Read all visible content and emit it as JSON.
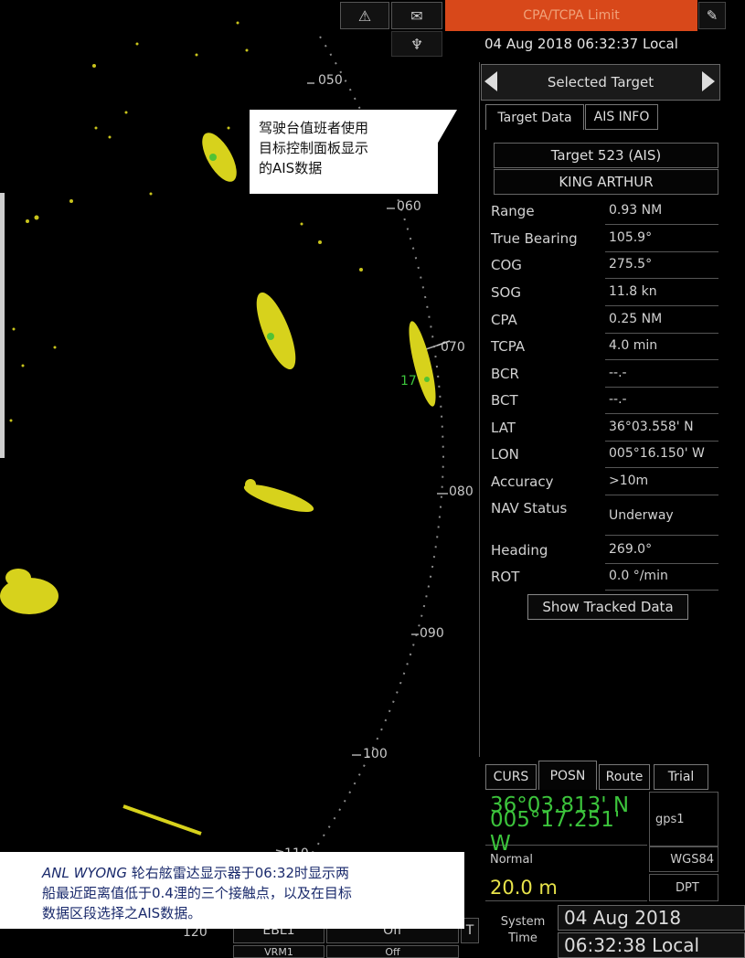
{
  "topbar": {
    "warning_icon": "warning-triangle-icon",
    "message_icon": "envelope-icon",
    "mob_icon": "person-overboard-icon",
    "pen_icon": "pencil-icon",
    "cpa_limit": "CPA/TCPA Limit",
    "datetime": "04 Aug 2018 06:32:37 Local"
  },
  "radar": {
    "bearings": [
      "050",
      "060",
      "070",
      "080",
      "090",
      "100",
      "110",
      "120"
    ],
    "target_label": "17",
    "colors": {
      "echo": "#d7d21c",
      "highlight": "#52c234",
      "label": "#3cc43c"
    }
  },
  "callout": {
    "text_line1": "驾驶台值班者使用",
    "text_line2": "目标控制面板显示",
    "text_line3": "的AIS数据"
  },
  "panel": {
    "header": "Selected Target",
    "tabs": [
      "Target Data",
      "AIS INFO"
    ],
    "target_id": "Target 523 (AIS)",
    "target_name": "KING ARTHUR",
    "rows": [
      {
        "label": "Range",
        "value": "0.93 NM"
      },
      {
        "label": "True Bearing",
        "value": "105.9°"
      },
      {
        "label": "COG",
        "value": "275.5°"
      },
      {
        "label": "SOG",
        "value": "11.8 kn"
      },
      {
        "label": "CPA",
        "value": "0.25 NM"
      },
      {
        "label": "TCPA",
        "value": "4.0 min"
      },
      {
        "label": "BCR",
        "value": "--.-"
      },
      {
        "label": "BCT",
        "value": "--.-"
      },
      {
        "label": "LAT",
        "value": "36°03.558' N"
      },
      {
        "label": "LON",
        "value": "005°16.150' W"
      },
      {
        "label": "Accuracy",
        "value": ">10m"
      },
      {
        "label": "NAV Status",
        "value": "Underway"
      },
      {
        "label": "Heading",
        "value": "269.0°"
      },
      {
        "label": "ROT",
        "value": "0.0 °/min"
      }
    ],
    "show_tracked": "Show Tracked Data"
  },
  "position": {
    "tabs": [
      "CURS",
      "POSN",
      "Route",
      "Trial"
    ],
    "lat": "36°03.813' N",
    "lon": "005°17.251' W",
    "source": "gps1",
    "mode": "Normal",
    "datum": "WGS84",
    "depth": "20.0 m",
    "depth_ref": "DPT",
    "system_time_label_1": "System",
    "system_time_label_2": "Time",
    "system_date": "04 Aug 2018",
    "system_time": "06:32:38 Local"
  },
  "bottom_controls": {
    "ebl1": "EBL1",
    "ebl1_state": "Off",
    "vrm1": "VRM1",
    "vrm1_state": "Off",
    "t_label": "T"
  },
  "caption": {
    "ship_name": "ANL WYONG",
    "text_line1": " 轮右舷雷达显示器于06:32时显示两",
    "text_line2": "船最近距离值低于0.4浬的三个接触点，以及在目标",
    "text_line3": "数据区段选择之AIS数据。"
  }
}
